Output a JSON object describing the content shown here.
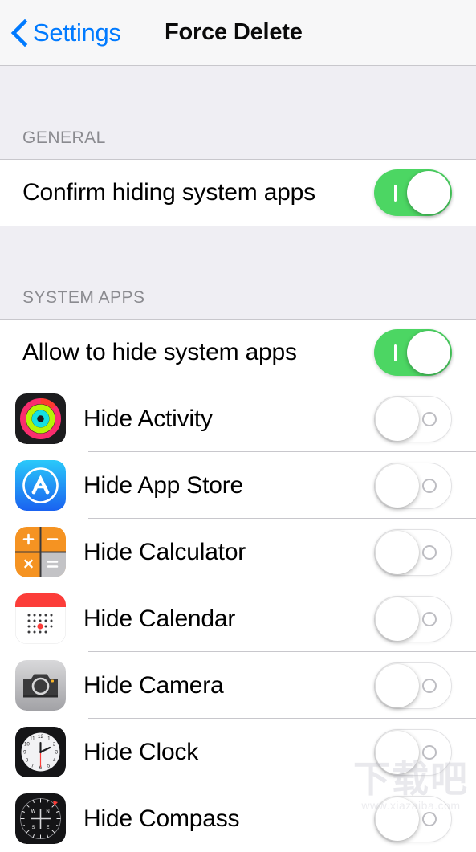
{
  "navbar": {
    "back_label": "Settings",
    "back_icon": "chevron-left-icon",
    "title": "Force Delete",
    "accent_color": "#007AFF"
  },
  "sections": [
    {
      "header": "GENERAL",
      "rows": [
        {
          "label": "Confirm hiding system apps",
          "toggle": "on",
          "icon": null
        }
      ]
    },
    {
      "header": "SYSTEM APPS",
      "rows": [
        {
          "label": "Allow to hide system apps",
          "toggle": "on",
          "icon": null
        },
        {
          "label": "Hide Activity",
          "toggle": "off",
          "icon": "activity-app-icon"
        },
        {
          "label": "Hide App Store",
          "toggle": "off",
          "icon": "app-store-app-icon"
        },
        {
          "label": "Hide Calculator",
          "toggle": "off",
          "icon": "calculator-app-icon"
        },
        {
          "label": "Hide Calendar",
          "toggle": "off",
          "icon": "calendar-app-icon"
        },
        {
          "label": "Hide Camera",
          "toggle": "off",
          "icon": "camera-app-icon"
        },
        {
          "label": "Hide Clock",
          "toggle": "off",
          "icon": "clock-app-icon"
        },
        {
          "label": "Hide Compass",
          "toggle": "off",
          "icon": "compass-app-icon"
        }
      ]
    }
  ],
  "colors": {
    "toggle_on": "#4CD663",
    "section_bg": "#EFEEF3",
    "separator": "#C8C7CC",
    "navbar_bg": "#F7F7F8",
    "header_text": "#8A8A8F"
  },
  "watermark": {
    "text": "下载吧",
    "url": "www.xiazaiba.com"
  }
}
